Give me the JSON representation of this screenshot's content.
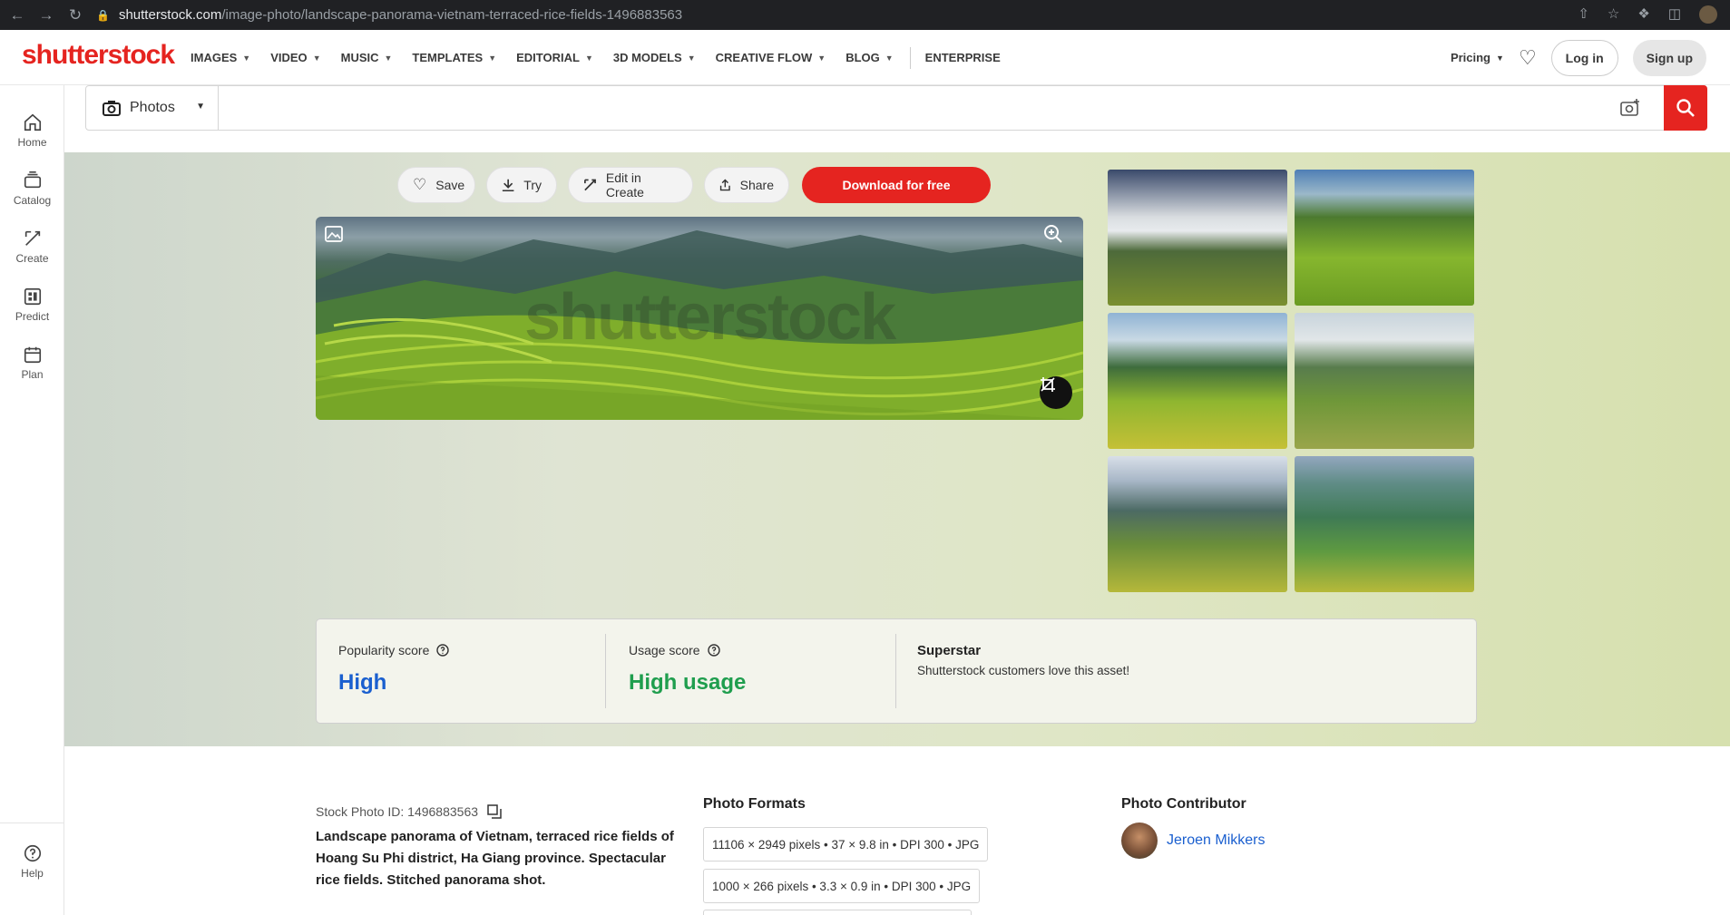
{
  "browser": {
    "url_domain": "shutterstock.com",
    "url_path": "/image-photo/landscape-panorama-vietnam-terraced-rice-fields-1496883563"
  },
  "brand": {
    "logo": "shutterstock",
    "accent": "#e52420"
  },
  "nav": {
    "items": [
      {
        "label": "IMAGES"
      },
      {
        "label": "VIDEO"
      },
      {
        "label": "MUSIC"
      },
      {
        "label": "TEMPLATES"
      },
      {
        "label": "EDITORIAL"
      },
      {
        "label": "3D MODELS"
      },
      {
        "label": "CREATIVE FLOW"
      },
      {
        "label": "BLOG"
      }
    ],
    "enterprise": "ENTERPRISE",
    "pricing": "Pricing",
    "login": "Log in",
    "signup": "Sign up"
  },
  "sidebar": {
    "items": [
      {
        "label": "Home",
        "icon": "home-icon"
      },
      {
        "label": "Catalog",
        "icon": "catalog-icon"
      },
      {
        "label": "Create",
        "icon": "create-icon"
      },
      {
        "label": "Predict",
        "icon": "predict-icon"
      },
      {
        "label": "Plan",
        "icon": "plan-icon"
      }
    ],
    "help": "Help"
  },
  "search": {
    "type": "Photos",
    "value": "",
    "placeholder": ""
  },
  "actions": {
    "save": "Save",
    "try": "Try",
    "edit": "Edit in Create",
    "share": "Share",
    "download": "Download for free"
  },
  "image": {
    "watermark": "shutterstock"
  },
  "scores": {
    "popularity_label": "Popularity score",
    "popularity_value": "High",
    "usage_label": "Usage score",
    "usage_value": "High usage",
    "superstar_title": "Superstar",
    "superstar_text": "Shutterstock customers love this asset!",
    "popularity_color": "#1a5fcf",
    "usage_color": "#1f9e4e"
  },
  "details": {
    "stock_id": "Stock Photo ID: 1496883563",
    "description": "Landscape panorama of Vietnam, terraced rice fields of Hoang Su Phi district, Ha Giang province. Spectacular rice fields. Stitched panorama shot.",
    "formats_title": "Photo Formats",
    "formats": [
      "11106 × 2949 pixels • 37 × 9.8 in • DPI 300 • JPG",
      "1000 × 266 pixels • 3.3 × 0.9 in • DPI 300 • JPG"
    ],
    "contributor_title": "Photo Contributor",
    "contributor_name": "Jeroen Mikkers"
  }
}
